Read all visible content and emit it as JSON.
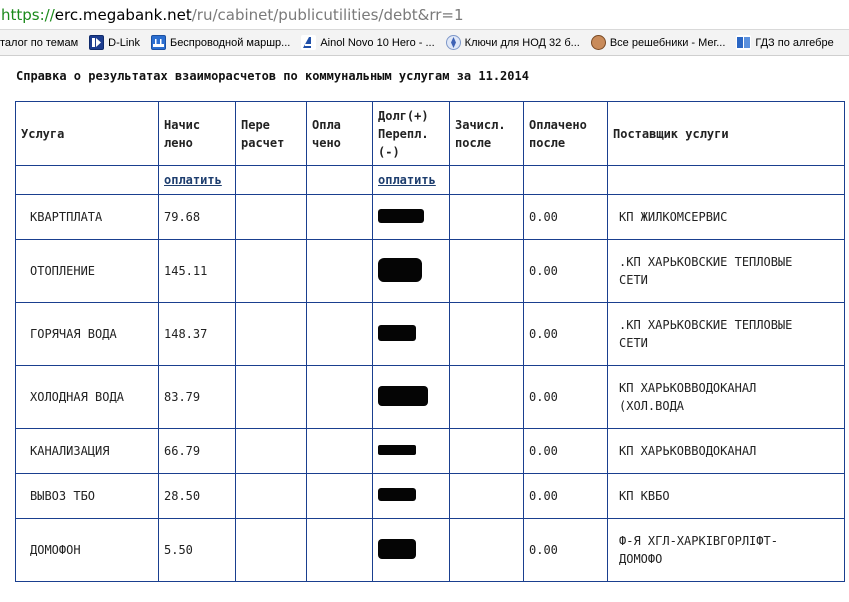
{
  "browser": {
    "url_scheme": "https://",
    "url_domain": "erc.megabank.net",
    "url_path": "/ru/cabinet/publicutilities/debt&rr=1"
  },
  "bookmarks": [
    {
      "label": "талог по темам",
      "icon": "none"
    },
    {
      "label": "D-Link",
      "icon": "dlink-icon"
    },
    {
      "label": "Беспроводной маршр...",
      "icon": "router-icon"
    },
    {
      "label": "Ainol Novo 10 Hero - ...",
      "icon": "ainol-icon"
    },
    {
      "label": "Ключи для НОД 32 б...",
      "icon": "nod-icon"
    },
    {
      "label": "Все решебники - Мег...",
      "icon": "avatar-icon"
    },
    {
      "label": "ГДЗ по алгебре",
      "icon": "gdz-icon"
    }
  ],
  "report": {
    "title": "Справка о результатах взаиморасчетов по коммунальным услугам за 11.2014",
    "columns": {
      "service": "Услуга",
      "charged_1": "Начис",
      "charged_2": "лено",
      "recalc_1": "Пере",
      "recalc_2": "расчет",
      "paid_1": "Опла",
      "paid_2": "чено",
      "debt_1": "Долг(+)",
      "debt_2": "Перепл.",
      "debt_3": "(-)",
      "credited_1": "Зачисл.",
      "credited_2": "после",
      "paid_after_1": "Оплачено",
      "paid_after_2": "после",
      "provider": "Поставщик услуги"
    },
    "pay_link_label": "оплатить",
    "rows": [
      {
        "service": "КВАРТПЛАТА",
        "charged": "79.68",
        "paid_after": "0.00",
        "provider_1": "КП ЖИЛКОМСЕРВИС",
        "provider_2": ""
      },
      {
        "service": "ОТОПЛЕНИЕ",
        "charged": "145.11",
        "paid_after": "0.00",
        "provider_1": ".КП ХАРЬКОВСКИЕ ТЕПЛОВЫЕ",
        "provider_2": "СЕТИ"
      },
      {
        "service": "ГОРЯЧАЯ ВОДА",
        "charged": "148.37",
        "paid_after": "0.00",
        "provider_1": ".КП ХАРЬКОВСКИЕ ТЕПЛОВЫЕ",
        "provider_2": "СЕТИ"
      },
      {
        "service": "ХОЛОДНАЯ ВОДА",
        "charged": "83.79",
        "paid_after": "0.00",
        "provider_1": "КП ХАРЬКОВВОДОКАНАЛ",
        "provider_2": "(ХОЛ.ВОДА"
      },
      {
        "service": "КАНАЛИЗАЦИЯ",
        "charged": "66.79",
        "paid_after": "0.00",
        "provider_1": "КП ХАРЬКОВВОДОКАНАЛ",
        "provider_2": ""
      },
      {
        "service": "ВЫВОЗ ТБО",
        "charged": "28.50",
        "paid_after": "0.00",
        "provider_1": "КП КВБО",
        "provider_2": ""
      },
      {
        "service": "ДОМОФОН",
        "charged": "5.50",
        "paid_after": "0.00",
        "provider_1": "Ф-Я ХГЛ-ХАРКІВГОРЛІФТ-",
        "provider_2": "ДОМОФО"
      }
    ]
  }
}
